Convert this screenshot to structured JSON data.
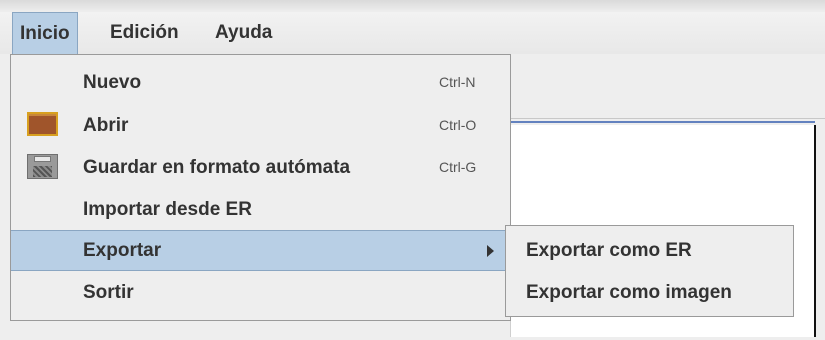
{
  "menubar": {
    "items": [
      {
        "label": "Inicio"
      },
      {
        "label": "Edición"
      },
      {
        "label": "Ayuda"
      }
    ]
  },
  "inicio_menu": {
    "items": [
      {
        "label": "Nuevo",
        "shortcut": "Ctrl-N"
      },
      {
        "label": "Abrir",
        "shortcut": "Ctrl-O",
        "icon": "folder-open-icon"
      },
      {
        "label": "Guardar en formato autómata",
        "shortcut": "Ctrl-G",
        "icon": "floppy-disk-icon"
      },
      {
        "label": "Importar desde ER"
      },
      {
        "label": "Exportar",
        "has_submenu": true
      },
      {
        "label": "Sortir"
      }
    ]
  },
  "exportar_submenu": {
    "items": [
      {
        "label": "Exportar como ER"
      },
      {
        "label": "Exportar como imagen"
      }
    ]
  },
  "colors": {
    "selection": "#b8cfe5",
    "menu_background": "#eeeeee",
    "accent_line": "#6382bf"
  }
}
